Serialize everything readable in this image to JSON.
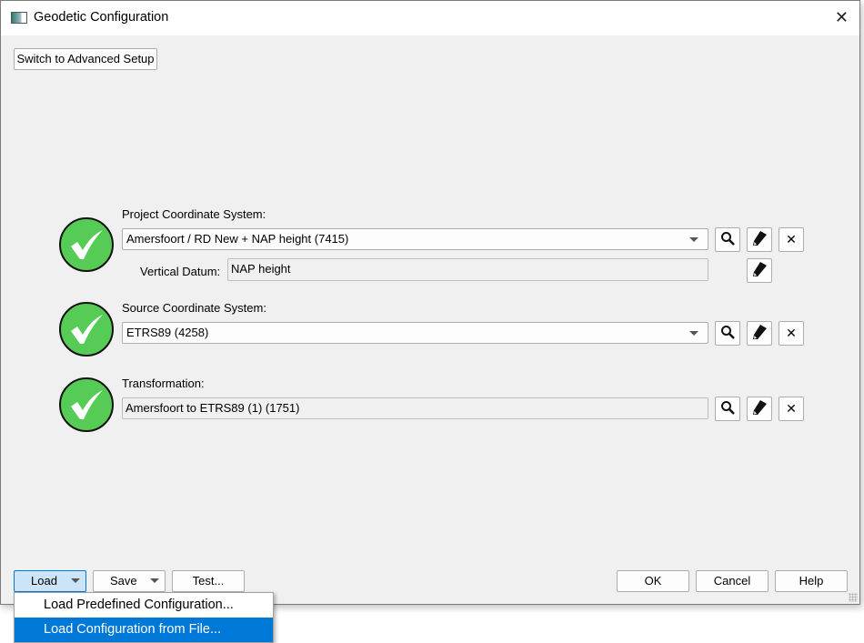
{
  "window": {
    "title": "Geodetic Configuration"
  },
  "toolbar": {
    "advanced_label": "Switch to Advanced Setup"
  },
  "project": {
    "label": "Project Coordinate System:",
    "value": "Amersfoort / RD New + NAP height (7415)",
    "vertical_label": "Vertical Datum:",
    "vertical_value": "NAP height"
  },
  "source": {
    "label": "Source Coordinate System:",
    "value": "ETRS89 (4258)"
  },
  "transformation": {
    "label": "Transformation:",
    "value": "Amersfoort to ETRS89 (1) (1751)"
  },
  "footer": {
    "load": "Load",
    "save": "Save",
    "test": "Test...",
    "ok": "OK",
    "cancel": "Cancel",
    "help": "Help"
  },
  "load_menu": {
    "items": [
      "Load Predefined Configuration...",
      "Load Configuration from File..."
    ]
  },
  "colors": {
    "status_ok": "#56cc56",
    "menu_highlight": "#0078d7"
  }
}
